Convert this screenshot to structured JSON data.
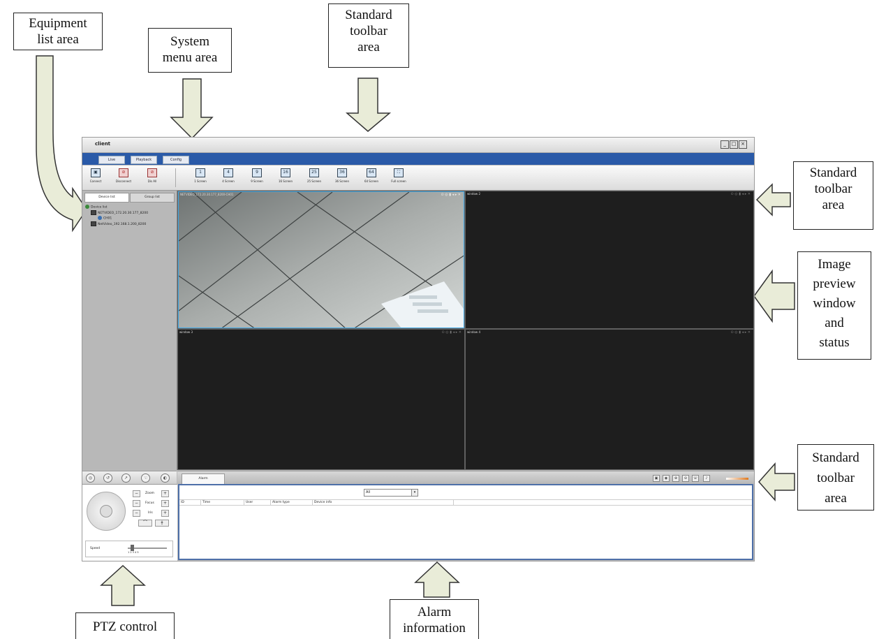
{
  "annotations": {
    "equipment_list": [
      "Equipment",
      "list area"
    ],
    "system_menu": [
      "System",
      "menu area"
    ],
    "standard_toolbar_top": [
      "Standard",
      "toolbar",
      "area"
    ],
    "standard_toolbar_right1": [
      "Standard",
      "toolbar",
      "area"
    ],
    "image_preview": [
      "Image",
      "preview",
      "window",
      "and",
      "status"
    ],
    "standard_toolbar_right2": [
      "Standard",
      "toolbar",
      "area"
    ],
    "ptz_control": [
      "PTZ control"
    ],
    "alarm_information": [
      "Alarm",
      "information"
    ]
  },
  "app": {
    "title": "client",
    "window_buttons": [
      "_",
      "□",
      "×"
    ],
    "menu": [
      "Live",
      "Playback",
      "Config"
    ],
    "toolbar": [
      {
        "label": "Connect",
        "icon": "connect-icon",
        "glyph": "▣"
      },
      {
        "label": "Disconnect",
        "icon": "disconnect-icon",
        "glyph": "⊘"
      },
      {
        "label": "Dis All",
        "icon": "disconnect-all-icon",
        "glyph": "⊘"
      },
      {
        "label": "1 Screen",
        "icon": "layout-1-icon",
        "glyph": "1"
      },
      {
        "label": "4 Screen",
        "icon": "layout-4-icon",
        "glyph": "4"
      },
      {
        "label": "9 Screen",
        "icon": "layout-9-icon",
        "glyph": "9"
      },
      {
        "label": "16 Screen",
        "icon": "layout-16-icon",
        "glyph": "16"
      },
      {
        "label": "25 Screen",
        "icon": "layout-25-icon",
        "glyph": "25"
      },
      {
        "label": "36 Screen",
        "icon": "layout-36-icon",
        "glyph": "36"
      },
      {
        "label": "64 Screen",
        "icon": "layout-64-icon",
        "glyph": "64"
      },
      {
        "label": "Full screen",
        "icon": "fullscreen-icon",
        "glyph": "⛶"
      }
    ],
    "left_tabs": [
      "Device list",
      "Group list"
    ],
    "tree": {
      "root": "Device list",
      "device1": "NETVIDEO_172.20.30.177_8200",
      "channel": "CH01",
      "device2": "NetVideo_192.168.1.200_8200"
    },
    "video": {
      "window1_caption": "NETVIDEO_172.20.30.177_8200-CH01",
      "window2_caption": "window 2",
      "window3_caption": "window 3",
      "window4_caption": "window 4",
      "controls": "⊙ ◎ ▮ ◂ ▸ ✕"
    },
    "ptz": {
      "zoom": "Zoom",
      "focus": "Focus",
      "iris": "Iris",
      "speed": "Speed",
      "speed_ticks": "1   2   3   4   5"
    },
    "alarm": {
      "tab": "Alarm",
      "filter": "All",
      "columns": [
        "ID",
        "Time",
        "User",
        "Alarm type",
        "Device info"
      ]
    }
  }
}
